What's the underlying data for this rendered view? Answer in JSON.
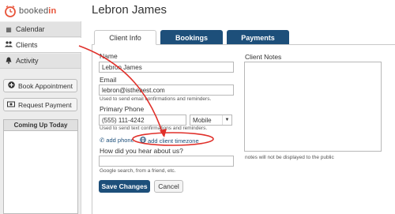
{
  "brand": {
    "name_prefix": "booked",
    "name_accent": "in",
    "accent_color": "#e8543a",
    "primary_color": "#1d4f7a"
  },
  "page_title": "Lebron James",
  "sidebar": {
    "items": [
      {
        "label": "Calendar",
        "icon": "calendar-icon"
      },
      {
        "label": "Clients",
        "icon": "users-icon"
      },
      {
        "label": "Activity",
        "icon": "bell-icon"
      }
    ],
    "buttons": [
      {
        "label": "Book Appointment",
        "icon": "plus-icon"
      },
      {
        "label": "Request Payment",
        "icon": "money-icon"
      }
    ],
    "coming_up": {
      "title": "Coming Up Today"
    }
  },
  "tabs": [
    {
      "label": "Client Info",
      "active": true
    },
    {
      "label": "Bookings",
      "active": false
    },
    {
      "label": "Payments",
      "active": false
    }
  ],
  "form": {
    "name": {
      "label": "Name",
      "value": "Lebron James"
    },
    "email": {
      "label": "Email",
      "value": "lebron@isthebest.com",
      "help": "Used to send email confirmations and reminders."
    },
    "phone": {
      "label": "Primary Phone",
      "value": "(555) 111-4242",
      "type": "Mobile",
      "help": "Used to send text confirmations and reminders."
    },
    "add_phone": "add phone",
    "add_timezone": "add client timezone",
    "referral": {
      "label": "How did you hear about us?",
      "value": "",
      "help": "Google search, from a friend, etc."
    },
    "notes": {
      "label": "Client Notes",
      "help": "notes will not be displayed to the public"
    },
    "save_label": "Save Changes",
    "cancel_label": "Cancel"
  }
}
